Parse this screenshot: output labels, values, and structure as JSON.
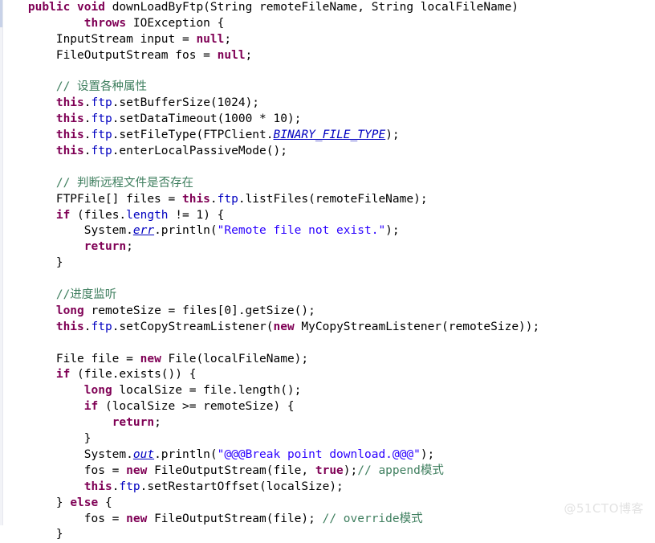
{
  "editor": {
    "language": "Java",
    "background_color": "#ffffff",
    "default_text_color": "#000000",
    "theme_colors": {
      "keyword": "#7f0055",
      "string": "#2a00ff",
      "comment": "#3f7f5f",
      "field": "#0000c0",
      "static_field": "#0000c0",
      "plain": "#000000",
      "gutter": "#f2f3f7"
    }
  },
  "watermark": {
    "text": "@51CTO博客"
  },
  "code": {
    "lines": [
      {
        "n": 1,
        "text": "    public void downLoadByFtp(String remoteFileName, String localFileName)",
        "tokens": [
          {
            "t": "    ",
            "c": "plain"
          },
          {
            "t": "public",
            "c": "kw"
          },
          {
            "t": " ",
            "c": "plain"
          },
          {
            "t": "void",
            "c": "kw"
          },
          {
            "t": " downLoadByFtp(String remoteFileName, String localFileName)",
            "c": "plain"
          }
        ]
      },
      {
        "n": 2,
        "text": "            throws IOException {",
        "tokens": [
          {
            "t": "            ",
            "c": "plain"
          },
          {
            "t": "throws",
            "c": "kw"
          },
          {
            "t": " IOException {",
            "c": "plain"
          }
        ]
      },
      {
        "n": 3,
        "text": "        InputStream input = null;",
        "tokens": [
          {
            "t": "        InputStream input = ",
            "c": "plain"
          },
          {
            "t": "null",
            "c": "kw"
          },
          {
            "t": ";",
            "c": "plain"
          }
        ]
      },
      {
        "n": 4,
        "text": "        FileOutputStream fos = null;",
        "tokens": [
          {
            "t": "        FileOutputStream fos = ",
            "c": "plain"
          },
          {
            "t": "null",
            "c": "kw"
          },
          {
            "t": ";",
            "c": "plain"
          }
        ]
      },
      {
        "n": 5,
        "text": "",
        "tokens": []
      },
      {
        "n": 6,
        "text": "        // 设置各种属性",
        "tokens": [
          {
            "t": "        ",
            "c": "plain"
          },
          {
            "t": "// 设置各种属性",
            "c": "cmt"
          }
        ]
      },
      {
        "n": 7,
        "text": "        this.ftp.setBufferSize(1024);",
        "tokens": [
          {
            "t": "        ",
            "c": "plain"
          },
          {
            "t": "this",
            "c": "kw"
          },
          {
            "t": ".",
            "c": "plain"
          },
          {
            "t": "ftp",
            "c": "fld"
          },
          {
            "t": ".setBufferSize(1024);",
            "c": "plain"
          }
        ]
      },
      {
        "n": 8,
        "text": "        this.ftp.setDataTimeout(1000 * 10);",
        "tokens": [
          {
            "t": "        ",
            "c": "plain"
          },
          {
            "t": "this",
            "c": "kw"
          },
          {
            "t": ".",
            "c": "plain"
          },
          {
            "t": "ftp",
            "c": "fld"
          },
          {
            "t": ".setDataTimeout(1000 * 10);",
            "c": "plain"
          }
        ]
      },
      {
        "n": 9,
        "text": "        this.ftp.setFileType(FTPClient.BINARY_FILE_TYPE);",
        "tokens": [
          {
            "t": "        ",
            "c": "plain"
          },
          {
            "t": "this",
            "c": "kw"
          },
          {
            "t": ".",
            "c": "plain"
          },
          {
            "t": "ftp",
            "c": "fld"
          },
          {
            "t": ".setFileType(FTPClient.",
            "c": "plain"
          },
          {
            "t": "BINARY_FILE_TYPE",
            "c": "sfld"
          },
          {
            "t": ");",
            "c": "plain"
          }
        ]
      },
      {
        "n": 10,
        "text": "        this.ftp.enterLocalPassiveMode();",
        "tokens": [
          {
            "t": "        ",
            "c": "plain"
          },
          {
            "t": "this",
            "c": "kw"
          },
          {
            "t": ".",
            "c": "plain"
          },
          {
            "t": "ftp",
            "c": "fld"
          },
          {
            "t": ".enterLocalPassiveMode();",
            "c": "plain"
          }
        ]
      },
      {
        "n": 11,
        "text": "",
        "tokens": []
      },
      {
        "n": 12,
        "text": "        // 判断远程文件是否存在",
        "tokens": [
          {
            "t": "        ",
            "c": "plain"
          },
          {
            "t": "// 判断远程文件是否存在",
            "c": "cmt"
          }
        ]
      },
      {
        "n": 13,
        "text": "        FTPFile[] files = this.ftp.listFiles(remoteFileName);",
        "tokens": [
          {
            "t": "        FTPFile[] files = ",
            "c": "plain"
          },
          {
            "t": "this",
            "c": "kw"
          },
          {
            "t": ".",
            "c": "plain"
          },
          {
            "t": "ftp",
            "c": "fld"
          },
          {
            "t": ".listFiles(remoteFileName);",
            "c": "plain"
          }
        ]
      },
      {
        "n": 14,
        "text": "        if (files.length != 1) {",
        "tokens": [
          {
            "t": "        ",
            "c": "plain"
          },
          {
            "t": "if",
            "c": "kw"
          },
          {
            "t": " (files.",
            "c": "plain"
          },
          {
            "t": "length",
            "c": "fld"
          },
          {
            "t": " != 1) {",
            "c": "plain"
          }
        ]
      },
      {
        "n": 15,
        "text": "            System.err.println(\"Remote file not exist.\");",
        "tokens": [
          {
            "t": "            System.",
            "c": "plain"
          },
          {
            "t": "err",
            "c": "sfld"
          },
          {
            "t": ".println(",
            "c": "plain"
          },
          {
            "t": "\"Remote file not exist.\"",
            "c": "str"
          },
          {
            "t": ");",
            "c": "plain"
          }
        ]
      },
      {
        "n": 16,
        "text": "            return;",
        "tokens": [
          {
            "t": "            ",
            "c": "plain"
          },
          {
            "t": "return",
            "c": "kw"
          },
          {
            "t": ";",
            "c": "plain"
          }
        ]
      },
      {
        "n": 17,
        "text": "        }",
        "tokens": [
          {
            "t": "        }",
            "c": "plain"
          }
        ]
      },
      {
        "n": 18,
        "text": "",
        "tokens": []
      },
      {
        "n": 19,
        "text": "        //进度监听",
        "tokens": [
          {
            "t": "        ",
            "c": "plain"
          },
          {
            "t": "//进度监听",
            "c": "cmt"
          }
        ]
      },
      {
        "n": 20,
        "text": "        long remoteSize = files[0].getSize();",
        "tokens": [
          {
            "t": "        ",
            "c": "plain"
          },
          {
            "t": "long",
            "c": "kw"
          },
          {
            "t": " remoteSize = files[0].getSize();",
            "c": "plain"
          }
        ]
      },
      {
        "n": 21,
        "text": "        this.ftp.setCopyStreamListener(new MyCopyStreamListener(remoteSize));",
        "tokens": [
          {
            "t": "        ",
            "c": "plain"
          },
          {
            "t": "this",
            "c": "kw"
          },
          {
            "t": ".",
            "c": "plain"
          },
          {
            "t": "ftp",
            "c": "fld"
          },
          {
            "t": ".setCopyStreamListener(",
            "c": "plain"
          },
          {
            "t": "new",
            "c": "kw"
          },
          {
            "t": " MyCopyStreamListener(remoteSize));",
            "c": "plain"
          }
        ]
      },
      {
        "n": 22,
        "text": "",
        "tokens": []
      },
      {
        "n": 23,
        "text": "        File file = new File(localFileName);",
        "tokens": [
          {
            "t": "        File file = ",
            "c": "plain"
          },
          {
            "t": "new",
            "c": "kw"
          },
          {
            "t": " File(localFileName);",
            "c": "plain"
          }
        ]
      },
      {
        "n": 24,
        "text": "        if (file.exists()) {",
        "tokens": [
          {
            "t": "        ",
            "c": "plain"
          },
          {
            "t": "if",
            "c": "kw"
          },
          {
            "t": " (file.exists()) {",
            "c": "plain"
          }
        ]
      },
      {
        "n": 25,
        "text": "            long localSize = file.length();",
        "tokens": [
          {
            "t": "            ",
            "c": "plain"
          },
          {
            "t": "long",
            "c": "kw"
          },
          {
            "t": " localSize = file.length();",
            "c": "plain"
          }
        ]
      },
      {
        "n": 26,
        "text": "            if (localSize >= remoteSize) {",
        "tokens": [
          {
            "t": "            ",
            "c": "plain"
          },
          {
            "t": "if",
            "c": "kw"
          },
          {
            "t": " (localSize >= remoteSize) {",
            "c": "plain"
          }
        ]
      },
      {
        "n": 27,
        "text": "                return;",
        "tokens": [
          {
            "t": "                ",
            "c": "plain"
          },
          {
            "t": "return",
            "c": "kw"
          },
          {
            "t": ";",
            "c": "plain"
          }
        ]
      },
      {
        "n": 28,
        "text": "            }",
        "tokens": [
          {
            "t": "            }",
            "c": "plain"
          }
        ]
      },
      {
        "n": 29,
        "text": "            System.out.println(\"@@@Break point download.@@@\");",
        "tokens": [
          {
            "t": "            System.",
            "c": "plain"
          },
          {
            "t": "out",
            "c": "sfld"
          },
          {
            "t": ".println(",
            "c": "plain"
          },
          {
            "t": "\"@@@Break point download.@@@\"",
            "c": "str"
          },
          {
            "t": ");",
            "c": "plain"
          }
        ]
      },
      {
        "n": 30,
        "text": "            fos = new FileOutputStream(file, true);// append模式",
        "tokens": [
          {
            "t": "            fos = ",
            "c": "plain"
          },
          {
            "t": "new",
            "c": "kw"
          },
          {
            "t": " FileOutputStream(file, ",
            "c": "plain"
          },
          {
            "t": "true",
            "c": "kw"
          },
          {
            "t": ");",
            "c": "plain"
          },
          {
            "t": "// append模式",
            "c": "cmt"
          }
        ]
      },
      {
        "n": 31,
        "text": "            this.ftp.setRestartOffset(localSize);",
        "tokens": [
          {
            "t": "            ",
            "c": "plain"
          },
          {
            "t": "this",
            "c": "kw"
          },
          {
            "t": ".",
            "c": "plain"
          },
          {
            "t": "ftp",
            "c": "fld"
          },
          {
            "t": ".setRestartOffset(localSize);",
            "c": "plain"
          }
        ]
      },
      {
        "n": 32,
        "text": "        } else {",
        "tokens": [
          {
            "t": "        } ",
            "c": "plain"
          },
          {
            "t": "else",
            "c": "kw"
          },
          {
            "t": " {",
            "c": "plain"
          }
        ]
      },
      {
        "n": 33,
        "text": "            fos = new FileOutputStream(file); // override模式",
        "tokens": [
          {
            "t": "            fos = ",
            "c": "plain"
          },
          {
            "t": "new",
            "c": "kw"
          },
          {
            "t": " FileOutputStream(file); ",
            "c": "plain"
          },
          {
            "t": "// override模式",
            "c": "cmt"
          }
        ]
      },
      {
        "n": 34,
        "text": "        }",
        "tokens": [
          {
            "t": "        }",
            "c": "plain"
          }
        ]
      }
    ]
  }
}
